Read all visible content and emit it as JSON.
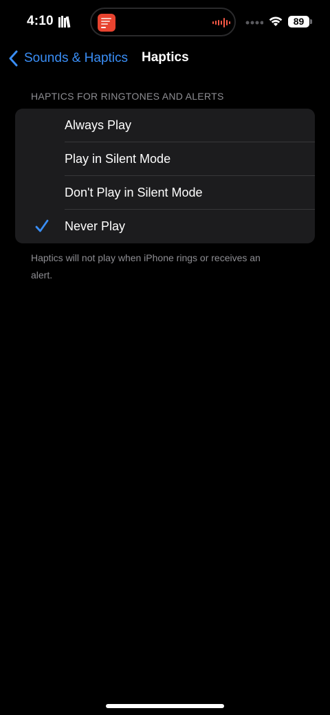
{
  "status_bar": {
    "time": "4:10",
    "battery": "89",
    "icons": [
      "books-icon",
      "voice-memo-icon",
      "signal-icon",
      "wifi-icon",
      "battery-icon"
    ]
  },
  "nav": {
    "back_label": "Sounds & Haptics",
    "title": "Haptics"
  },
  "section": {
    "header": "HAPTICS FOR RINGTONES AND ALERTS",
    "options": [
      {
        "label": "Always Play",
        "selected": false
      },
      {
        "label": "Play in Silent Mode",
        "selected": false
      },
      {
        "label": "Don't Play in Silent Mode",
        "selected": false
      },
      {
        "label": "Never Play",
        "selected": true
      }
    ],
    "footer": "Haptics will not play when iPhone rings or receives an alert."
  },
  "colors": {
    "accent": "#3a8ef6",
    "background": "#000000",
    "group_background": "#1c1c1e",
    "secondary_text": "#8e8e93",
    "island_icon": "#e8432f",
    "waveform": "#ff5a47"
  }
}
